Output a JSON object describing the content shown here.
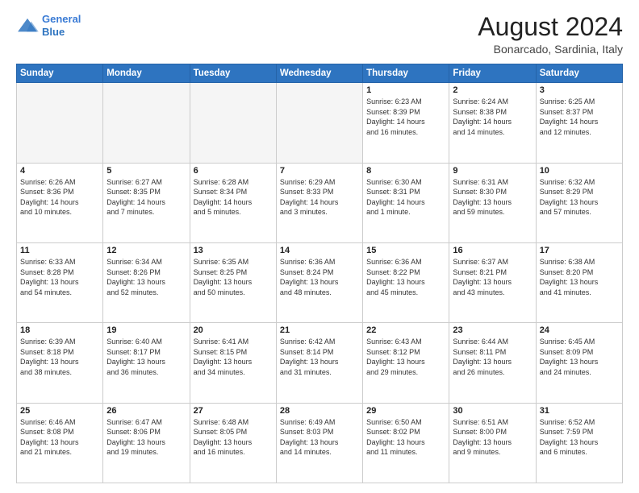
{
  "logo": {
    "line1": "General",
    "line2": "Blue"
  },
  "title": "August 2024",
  "subtitle": "Bonarcado, Sardinia, Italy",
  "weekdays": [
    "Sunday",
    "Monday",
    "Tuesday",
    "Wednesday",
    "Thursday",
    "Friday",
    "Saturday"
  ],
  "weeks": [
    [
      {
        "day": "",
        "info": ""
      },
      {
        "day": "",
        "info": ""
      },
      {
        "day": "",
        "info": ""
      },
      {
        "day": "",
        "info": ""
      },
      {
        "day": "1",
        "info": "Sunrise: 6:23 AM\nSunset: 8:39 PM\nDaylight: 14 hours\nand 16 minutes."
      },
      {
        "day": "2",
        "info": "Sunrise: 6:24 AM\nSunset: 8:38 PM\nDaylight: 14 hours\nand 14 minutes."
      },
      {
        "day": "3",
        "info": "Sunrise: 6:25 AM\nSunset: 8:37 PM\nDaylight: 14 hours\nand 12 minutes."
      }
    ],
    [
      {
        "day": "4",
        "info": "Sunrise: 6:26 AM\nSunset: 8:36 PM\nDaylight: 14 hours\nand 10 minutes."
      },
      {
        "day": "5",
        "info": "Sunrise: 6:27 AM\nSunset: 8:35 PM\nDaylight: 14 hours\nand 7 minutes."
      },
      {
        "day": "6",
        "info": "Sunrise: 6:28 AM\nSunset: 8:34 PM\nDaylight: 14 hours\nand 5 minutes."
      },
      {
        "day": "7",
        "info": "Sunrise: 6:29 AM\nSunset: 8:33 PM\nDaylight: 14 hours\nand 3 minutes."
      },
      {
        "day": "8",
        "info": "Sunrise: 6:30 AM\nSunset: 8:31 PM\nDaylight: 14 hours\nand 1 minute."
      },
      {
        "day": "9",
        "info": "Sunrise: 6:31 AM\nSunset: 8:30 PM\nDaylight: 13 hours\nand 59 minutes."
      },
      {
        "day": "10",
        "info": "Sunrise: 6:32 AM\nSunset: 8:29 PM\nDaylight: 13 hours\nand 57 minutes."
      }
    ],
    [
      {
        "day": "11",
        "info": "Sunrise: 6:33 AM\nSunset: 8:28 PM\nDaylight: 13 hours\nand 54 minutes."
      },
      {
        "day": "12",
        "info": "Sunrise: 6:34 AM\nSunset: 8:26 PM\nDaylight: 13 hours\nand 52 minutes."
      },
      {
        "day": "13",
        "info": "Sunrise: 6:35 AM\nSunset: 8:25 PM\nDaylight: 13 hours\nand 50 minutes."
      },
      {
        "day": "14",
        "info": "Sunrise: 6:36 AM\nSunset: 8:24 PM\nDaylight: 13 hours\nand 48 minutes."
      },
      {
        "day": "15",
        "info": "Sunrise: 6:36 AM\nSunset: 8:22 PM\nDaylight: 13 hours\nand 45 minutes."
      },
      {
        "day": "16",
        "info": "Sunrise: 6:37 AM\nSunset: 8:21 PM\nDaylight: 13 hours\nand 43 minutes."
      },
      {
        "day": "17",
        "info": "Sunrise: 6:38 AM\nSunset: 8:20 PM\nDaylight: 13 hours\nand 41 minutes."
      }
    ],
    [
      {
        "day": "18",
        "info": "Sunrise: 6:39 AM\nSunset: 8:18 PM\nDaylight: 13 hours\nand 38 minutes."
      },
      {
        "day": "19",
        "info": "Sunrise: 6:40 AM\nSunset: 8:17 PM\nDaylight: 13 hours\nand 36 minutes."
      },
      {
        "day": "20",
        "info": "Sunrise: 6:41 AM\nSunset: 8:15 PM\nDaylight: 13 hours\nand 34 minutes."
      },
      {
        "day": "21",
        "info": "Sunrise: 6:42 AM\nSunset: 8:14 PM\nDaylight: 13 hours\nand 31 minutes."
      },
      {
        "day": "22",
        "info": "Sunrise: 6:43 AM\nSunset: 8:12 PM\nDaylight: 13 hours\nand 29 minutes."
      },
      {
        "day": "23",
        "info": "Sunrise: 6:44 AM\nSunset: 8:11 PM\nDaylight: 13 hours\nand 26 minutes."
      },
      {
        "day": "24",
        "info": "Sunrise: 6:45 AM\nSunset: 8:09 PM\nDaylight: 13 hours\nand 24 minutes."
      }
    ],
    [
      {
        "day": "25",
        "info": "Sunrise: 6:46 AM\nSunset: 8:08 PM\nDaylight: 13 hours\nand 21 minutes."
      },
      {
        "day": "26",
        "info": "Sunrise: 6:47 AM\nSunset: 8:06 PM\nDaylight: 13 hours\nand 19 minutes."
      },
      {
        "day": "27",
        "info": "Sunrise: 6:48 AM\nSunset: 8:05 PM\nDaylight: 13 hours\nand 16 minutes."
      },
      {
        "day": "28",
        "info": "Sunrise: 6:49 AM\nSunset: 8:03 PM\nDaylight: 13 hours\nand 14 minutes."
      },
      {
        "day": "29",
        "info": "Sunrise: 6:50 AM\nSunset: 8:02 PM\nDaylight: 13 hours\nand 11 minutes."
      },
      {
        "day": "30",
        "info": "Sunrise: 6:51 AM\nSunset: 8:00 PM\nDaylight: 13 hours\nand 9 minutes."
      },
      {
        "day": "31",
        "info": "Sunrise: 6:52 AM\nSunset: 7:59 PM\nDaylight: 13 hours\nand 6 minutes."
      }
    ]
  ]
}
